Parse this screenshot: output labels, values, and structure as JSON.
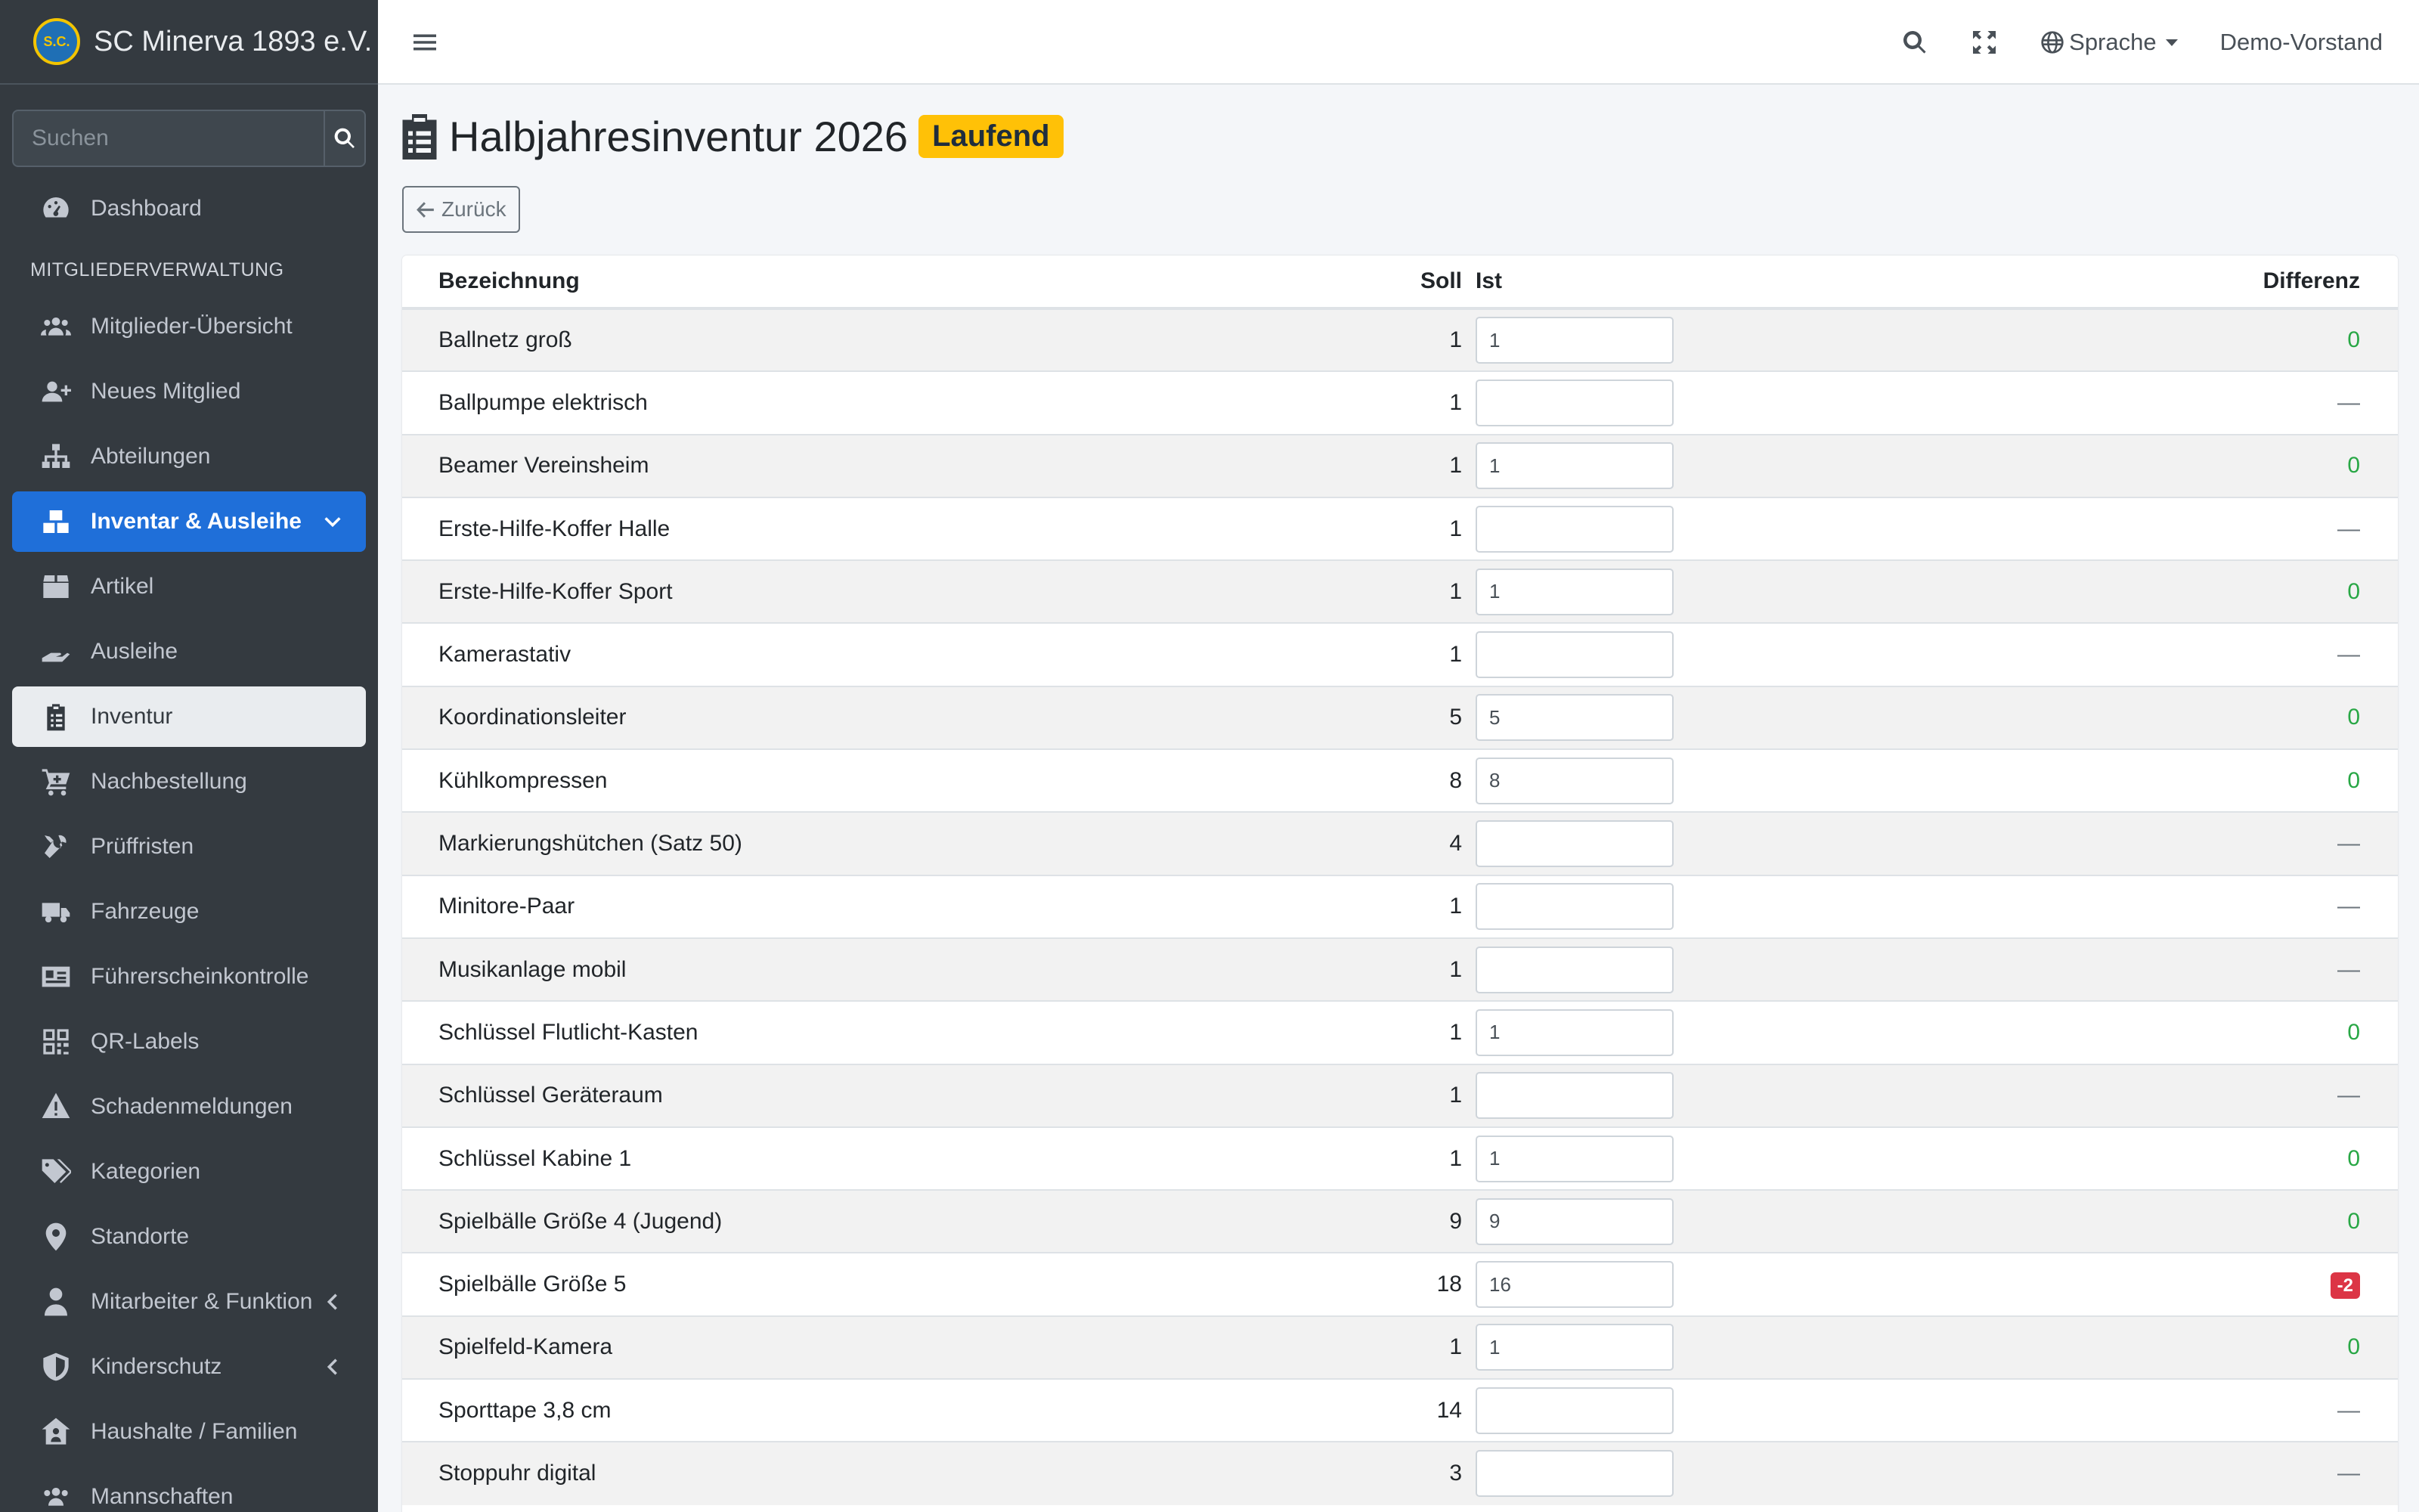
{
  "brand": {
    "name": "SC Minerva 1893 e.V.",
    "logo_text": "S.C."
  },
  "sidebar": {
    "search_placeholder": "Suchen",
    "section_header": "MITGLIEDERVERWALTUNG",
    "items": [
      {
        "label": "Dashboard",
        "icon": "tachometer-icon"
      },
      {
        "label": "Mitglieder-Übersicht",
        "icon": "users-icon"
      },
      {
        "label": "Neues Mitglied",
        "icon": "user-plus-icon"
      },
      {
        "label": "Abteilungen",
        "icon": "sitemap-icon"
      },
      {
        "label": "Inventar & Ausleihe",
        "icon": "boxes-icon"
      },
      {
        "label": "Artikel",
        "icon": "box-icon"
      },
      {
        "label": "Ausleihe",
        "icon": "hand-icon"
      },
      {
        "label": "Inventur",
        "icon": "clipboard-list-icon"
      },
      {
        "label": "Nachbestellung",
        "icon": "cart-plus-icon"
      },
      {
        "label": "Prüffristen",
        "icon": "tools-icon"
      },
      {
        "label": "Fahrzeuge",
        "icon": "truck-icon"
      },
      {
        "label": "Führerscheinkontrolle",
        "icon": "id-card-icon"
      },
      {
        "label": "QR-Labels",
        "icon": "qrcode-icon"
      },
      {
        "label": "Schadenmeldungen",
        "icon": "warning-icon"
      },
      {
        "label": "Kategorien",
        "icon": "tags-icon"
      },
      {
        "label": "Standorte",
        "icon": "map-marker-icon"
      },
      {
        "label": "Mitarbeiter & Funktion",
        "icon": "user-tie-icon"
      },
      {
        "label": "Kinderschutz",
        "icon": "shield-icon"
      },
      {
        "label": "Haushalte / Familien",
        "icon": "house-user-icon"
      },
      {
        "label": "Mannschaften",
        "icon": "users-icon"
      }
    ]
  },
  "topbar": {
    "language_label": "Sprache",
    "user_label": "Demo-Vorstand"
  },
  "page": {
    "title": "Halbjahresinventur 2026",
    "status": "Laufend",
    "back_label": "Zurück"
  },
  "table": {
    "headers": {
      "name": "Bezeichnung",
      "soll": "Soll",
      "ist": "Ist",
      "diff": "Differenz"
    },
    "rows": [
      {
        "name": "Ballnetz groß",
        "soll": "1",
        "ist": "1",
        "diff": "0"
      },
      {
        "name": "Ballpumpe elektrisch",
        "soll": "1",
        "ist": "",
        "diff": "—"
      },
      {
        "name": "Beamer Vereinsheim",
        "soll": "1",
        "ist": "1",
        "diff": "0"
      },
      {
        "name": "Erste-Hilfe-Koffer Halle",
        "soll": "1",
        "ist": "",
        "diff": "—"
      },
      {
        "name": "Erste-Hilfe-Koffer Sport",
        "soll": "1",
        "ist": "1",
        "diff": "0"
      },
      {
        "name": "Kamerastativ",
        "soll": "1",
        "ist": "",
        "diff": "—"
      },
      {
        "name": "Koordinationsleiter",
        "soll": "5",
        "ist": "5",
        "diff": "0"
      },
      {
        "name": "Kühlkompressen",
        "soll": "8",
        "ist": "8",
        "diff": "0"
      },
      {
        "name": "Markierungshütchen (Satz 50)",
        "soll": "4",
        "ist": "",
        "diff": "—"
      },
      {
        "name": "Minitore-Paar",
        "soll": "1",
        "ist": "",
        "diff": "—"
      },
      {
        "name": "Musikanlage mobil",
        "soll": "1",
        "ist": "",
        "diff": "—"
      },
      {
        "name": "Schlüssel Flutlicht-Kasten",
        "soll": "1",
        "ist": "1",
        "diff": "0"
      },
      {
        "name": "Schlüssel Geräteraum",
        "soll": "1",
        "ist": "",
        "diff": "—"
      },
      {
        "name": "Schlüssel Kabine 1",
        "soll": "1",
        "ist": "1",
        "diff": "0"
      },
      {
        "name": "Spielbälle Größe 4 (Jugend)",
        "soll": "9",
        "ist": "9",
        "diff": "0"
      },
      {
        "name": "Spielbälle Größe 5",
        "soll": "18",
        "ist": "16",
        "diff": "-2"
      },
      {
        "name": "Spielfeld-Kamera",
        "soll": "1",
        "ist": "1",
        "diff": "0"
      },
      {
        "name": "Sporttape 3,8 cm",
        "soll": "14",
        "ist": "",
        "diff": "—"
      },
      {
        "name": "Stoppuhr digital",
        "soll": "3",
        "ist": "",
        "diff": "—"
      }
    ]
  },
  "colors": {
    "sidebar_bg": "#343a40",
    "active_blue": "#1f6fd9",
    "status_yellow": "#ffc107",
    "diff_zero": "#28a745",
    "diff_negative": "#dc3545"
  }
}
